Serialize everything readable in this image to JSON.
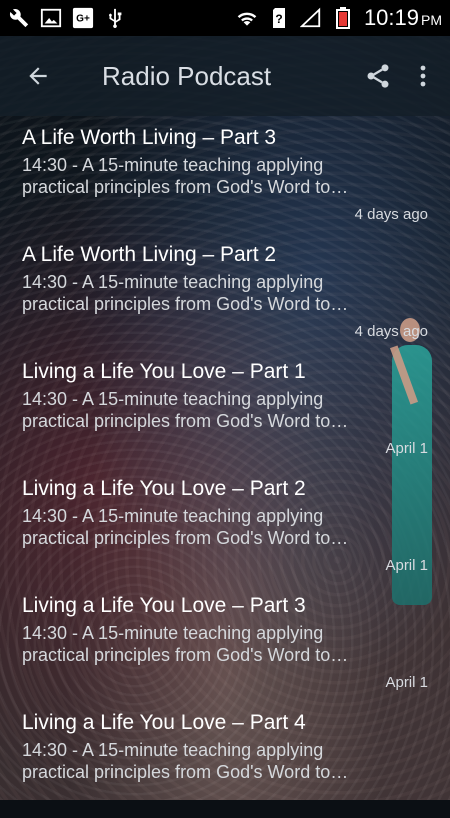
{
  "status_bar": {
    "time": "10:19",
    "ampm": "PM",
    "left_icons": [
      "wrench-icon",
      "image-icon",
      "gplus-icon",
      "usb-icon"
    ],
    "right_icons": [
      "wifi-icon",
      "sim-unknown-icon",
      "signal-icon",
      "battery-low-icon"
    ],
    "gplus_text": "G+",
    "sim_text": "?"
  },
  "app_bar": {
    "title": "Radio Podcast"
  },
  "episodes": [
    {
      "title": "A Life Worth Living – Part 3",
      "description": "14:30 - A 15-minute teaching applying practical principles from God's Word to…",
      "date": "4 days ago"
    },
    {
      "title": "A Life Worth Living – Part 2",
      "description": "14:30 - A 15-minute teaching applying practical principles from God's Word to…",
      "date": "4 days ago"
    },
    {
      "title": "Living a Life You Love – Part 1",
      "description": "14:30 - A 15-minute teaching applying practical principles from God's Word to…",
      "date": "April 1"
    },
    {
      "title": "Living a Life You Love – Part 2",
      "description": "14:30 - A 15-minute teaching applying practical principles from God's Word to…",
      "date": "April 1"
    },
    {
      "title": "Living a Life You Love – Part 3",
      "description": "14:30 - A 15-minute teaching applying practical principles from God's Word to…",
      "date": "April 1"
    },
    {
      "title": "Living a Life You Love – Part 4",
      "description": "14:30 - A 15-minute teaching applying practical principles from God's Word to…",
      "date": ""
    }
  ],
  "colors": {
    "appbar_bg": "#141e28",
    "statusbar_bg": "#000000",
    "battery_red": "#e53935"
  }
}
